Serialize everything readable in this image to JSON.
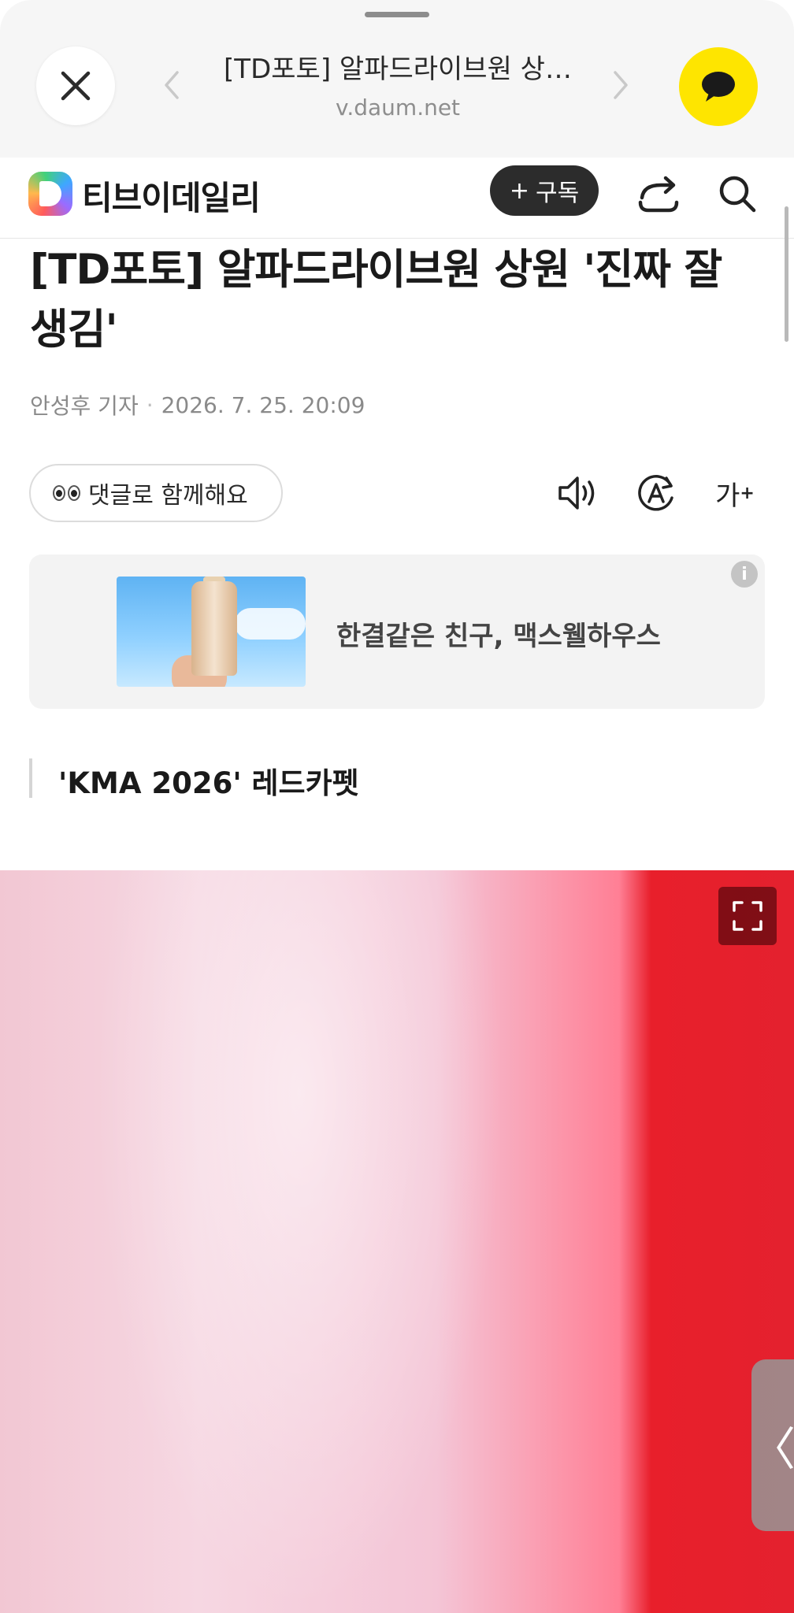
{
  "browser": {
    "page_title": "[TD포토] 알파드라이브원 상…",
    "url": "v.daum.net",
    "close_icon": "close-icon",
    "back_icon": "chevron-left-icon",
    "forward_icon": "chevron-right-icon",
    "kakao_icon": "kakaotalk-chat-icon"
  },
  "site": {
    "name": "티브이데일리",
    "subscribe_label": "구독",
    "subscribe_plus": "+",
    "share_icon": "share-icon",
    "search_icon": "search-icon"
  },
  "article": {
    "headline": "[TD포토] 알파드라이브원 상원 '진짜 잘 생김'",
    "author": "안성후 기자",
    "separator": "·",
    "datetime": "2026. 7. 25. 20:09",
    "comment_label": "댓글로 함께해요",
    "font_size_label": "가",
    "font_size_plus": "+",
    "subtitle": "'KMA 2026' 레드카펫"
  },
  "ad": {
    "text": "한결같은 친구, 맥스웰하우스",
    "info_label": "i"
  },
  "photo": {
    "fullscreen_icon": "fullscreen-icon",
    "side_tab_label": "〈"
  },
  "colors": {
    "kakao_yellow": "#fee500",
    "subscribe_bg": "#2c2c2c",
    "photo_red": "#e4212e"
  }
}
